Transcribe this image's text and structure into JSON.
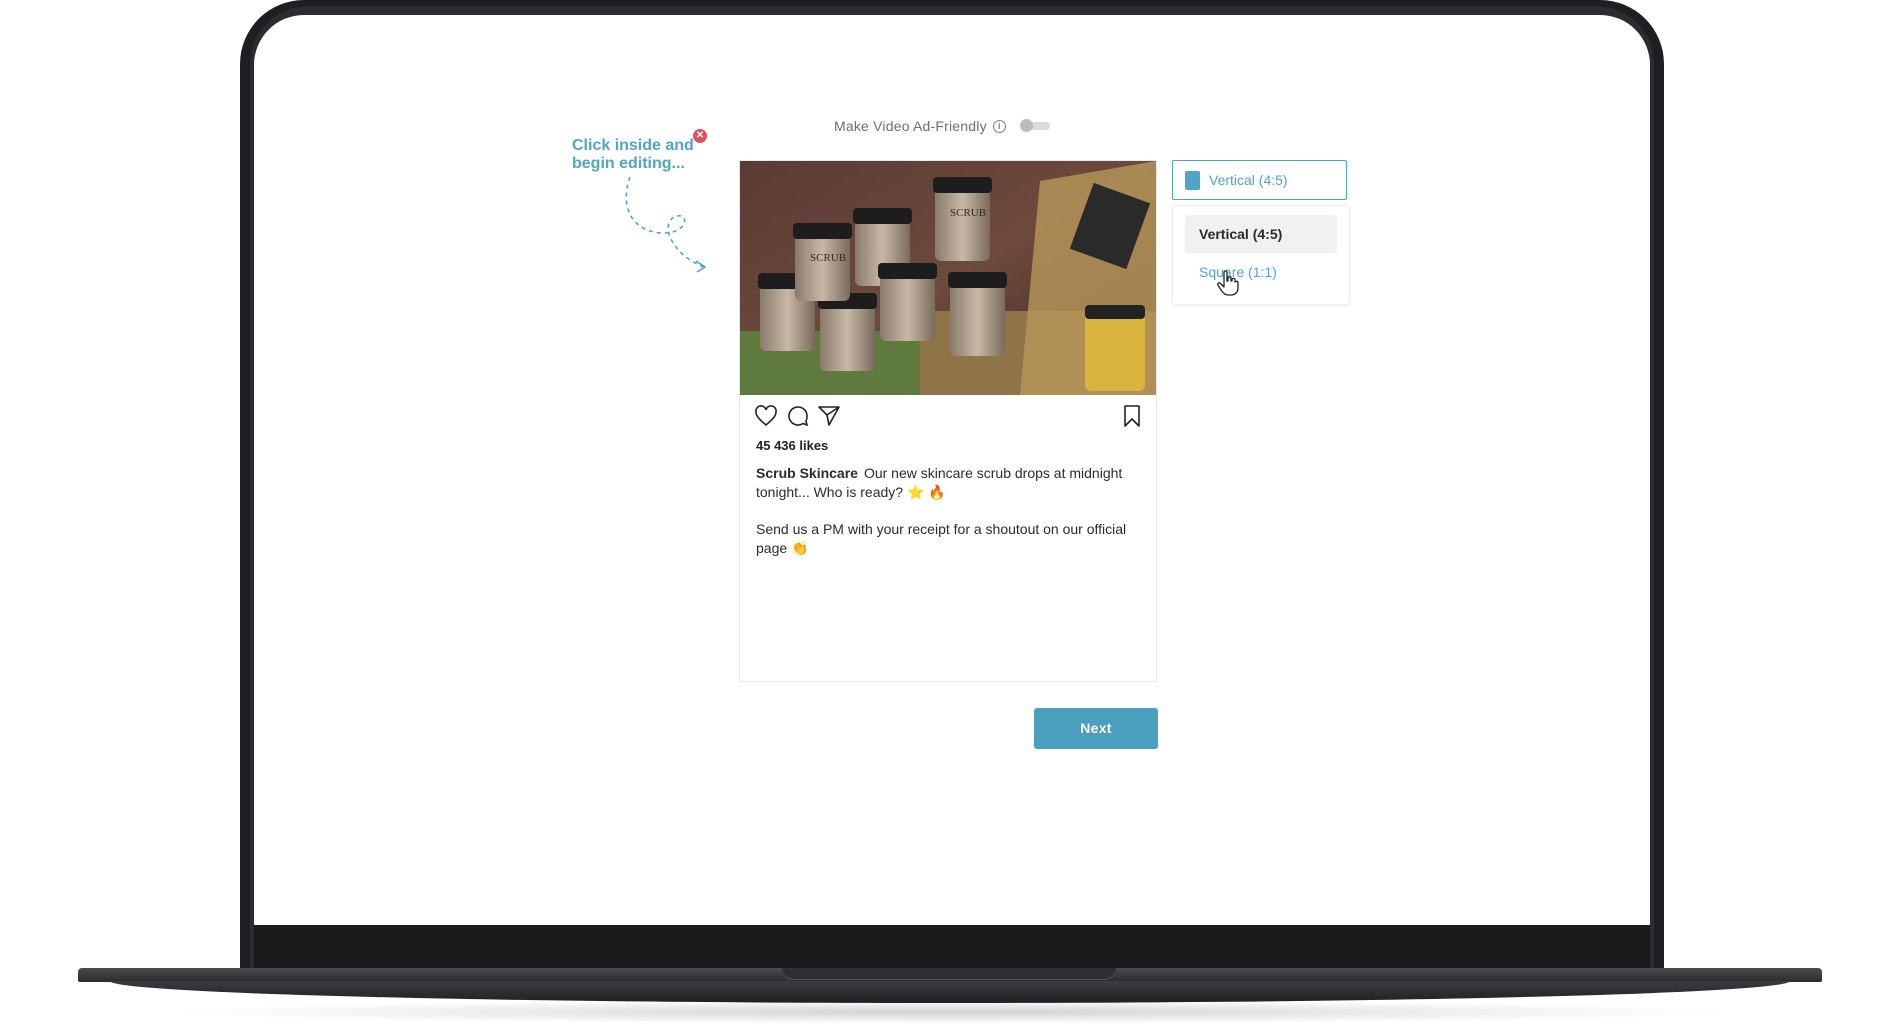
{
  "editor": {
    "toggle_label": "Make Video Ad-Friendly",
    "toggle_on": false,
    "info_glyph": "i",
    "hint_text": "Click inside and begin editing...",
    "hint_close_glyph": "✕",
    "next_label": "Next"
  },
  "post": {
    "likes": "45 436 likes",
    "username": "Scrub Skincare",
    "caption_line1": "Our new skincare scrub drops at midnight tonight... Who is ready? ⭐ 🔥",
    "caption_line2": "Send us a PM with your receipt for a shoutout on our official page 👏",
    "image_label": "SCRUB"
  },
  "format_select": {
    "selected": "Vertical (4:5)",
    "options": [
      "Vertical (4:5)",
      "Square (1:1)"
    ],
    "hovered_option": "Square (1:1)"
  },
  "colors": {
    "accent": "#4ea6c4",
    "button": "#4a9fbe",
    "hint_close": "#e0525b",
    "laptop_frame": "#1e1f22"
  }
}
